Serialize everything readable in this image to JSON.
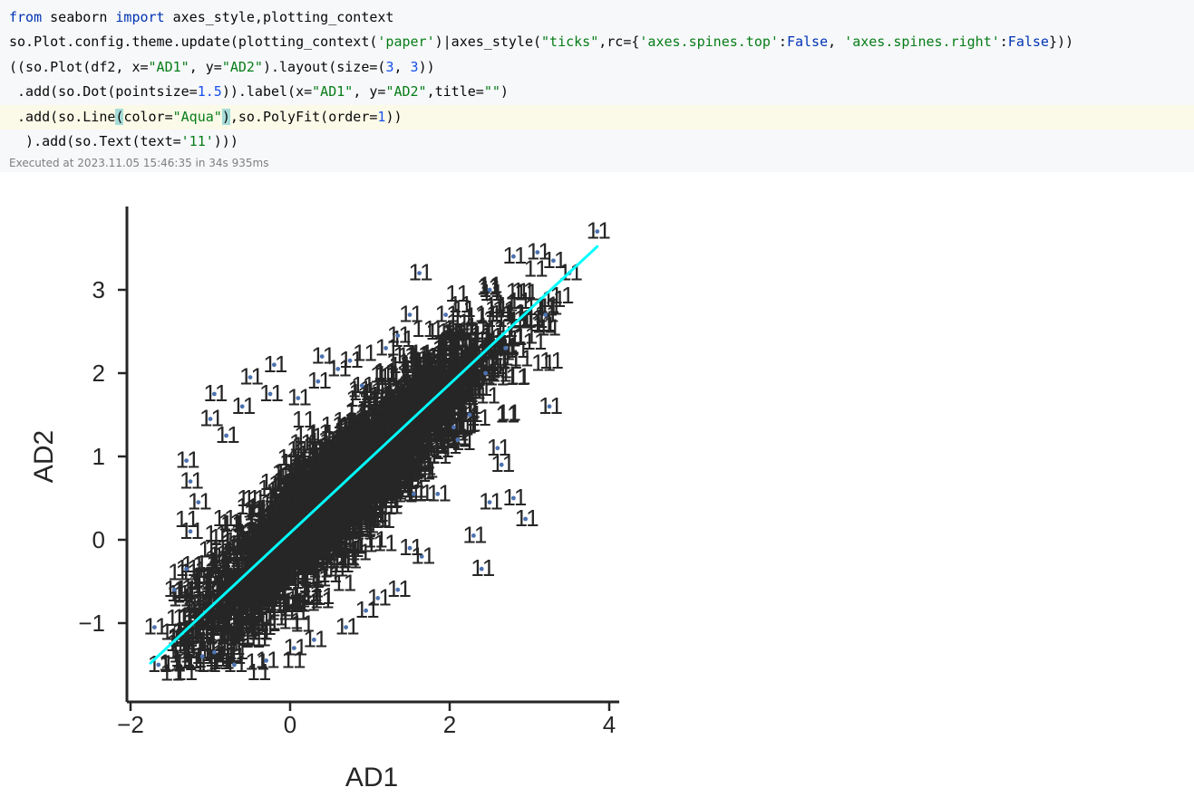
{
  "notebook": {
    "code_lines": [
      [
        {
          "t": "from",
          "c": "kw"
        },
        {
          "t": " seaborn "
        },
        {
          "t": "import",
          "c": "kw"
        },
        {
          "t": " axes_style,plotting_context"
        }
      ],
      [
        {
          "t": "so.Plot.config.theme.update(plotting_context("
        },
        {
          "t": "'paper'",
          "c": "st"
        },
        {
          "t": ")|axes_style("
        },
        {
          "t": "\"ticks\"",
          "c": "st"
        },
        {
          "t": ",rc={"
        },
        {
          "t": "'axes.spines.top'",
          "c": "st"
        },
        {
          "t": ":"
        },
        {
          "t": "False",
          "c": "kw"
        },
        {
          "t": ", "
        },
        {
          "t": "'axes.spines.right'",
          "c": "st"
        },
        {
          "t": ":"
        },
        {
          "t": "False",
          "c": "kw"
        },
        {
          "t": "}))"
        }
      ],
      [
        {
          "t": "((so.Plot(df2, x="
        },
        {
          "t": "\"AD1\"",
          "c": "st"
        },
        {
          "t": ", y="
        },
        {
          "t": "\"AD2\"",
          "c": "st"
        },
        {
          "t": ").layout(size=("
        },
        {
          "t": "3",
          "c": "nu"
        },
        {
          "t": ", "
        },
        {
          "t": "3",
          "c": "nu"
        },
        {
          "t": "))"
        }
      ],
      [
        {
          "t": " .add(so.Dot(pointsize="
        },
        {
          "t": "1.5",
          "c": "nu"
        },
        {
          "t": ")).label(x="
        },
        {
          "t": "\"AD1\"",
          "c": "st"
        },
        {
          "t": ", y="
        },
        {
          "t": "\"AD2\"",
          "c": "st"
        },
        {
          "t": ",title="
        },
        {
          "t": "\"\"",
          "c": "st"
        },
        {
          "t": ")"
        }
      ],
      [
        {
          "t": " .add(so.Line"
        },
        {
          "t": "(",
          "c": "par"
        },
        {
          "t": "color="
        },
        {
          "t": "\"Aqua\"",
          "c": "st"
        },
        {
          "t": ")",
          "c": "par"
        },
        {
          "t": ",so.PolyFit(order="
        },
        {
          "t": "1",
          "c": "nu"
        },
        {
          "t": "))"
        }
      ],
      [
        {
          "t": "  ).add(so.Text(text="
        },
        {
          "t": "'11'",
          "c": "st"
        },
        {
          "t": ")))"
        }
      ]
    ],
    "highlighted_line": 4,
    "execution_info": "Executed at 2023.11.05 15:46:35 in 34s 935ms"
  },
  "chart_data": {
    "type": "scatter",
    "xlabel": "AD1",
    "ylabel": "AD2",
    "title": "",
    "xlim": [
      -2,
      4
    ],
    "ylim": [
      -2,
      4
    ],
    "xticks": [
      -2,
      0,
      2,
      4
    ],
    "yticks": [
      -1,
      0,
      1,
      2,
      3
    ],
    "xtick_labels": [
      "−2",
      "0",
      "2",
      "4"
    ],
    "ytick_labels": [
      "−1",
      "0",
      "1",
      "2",
      "3"
    ],
    "point_text": "11",
    "colors": {
      "dot": "#4c72b0",
      "line": "#00ffff",
      "text": "#262626"
    },
    "fit_line": {
      "x": [
        -1.75,
        3.85
      ],
      "y": [
        -1.48,
        3.52
      ]
    },
    "outlier_points": [
      {
        "x": 3.85,
        "y": 3.7
      },
      {
        "x": 1.62,
        "y": 3.2
      },
      {
        "x": 1.5,
        "y": 2.7
      },
      {
        "x": 1.35,
        "y": 2.45
      },
      {
        "x": 0.75,
        "y": 2.15
      },
      {
        "x": 0.6,
        "y": 2.05
      },
      {
        "x": 0.35,
        "y": 1.9
      },
      {
        "x": -0.2,
        "y": 2.1
      },
      {
        "x": -0.5,
        "y": 1.95
      },
      {
        "x": -0.95,
        "y": 1.75
      },
      {
        "x": -1.3,
        "y": 0.95
      },
      {
        "x": -1.25,
        "y": 0.7
      },
      {
        "x": 3.25,
        "y": 1.6
      },
      {
        "x": 2.6,
        "y": 1.1
      },
      {
        "x": 2.65,
        "y": 0.9
      },
      {
        "x": 2.5,
        "y": 0.45
      },
      {
        "x": 2.8,
        "y": 0.5
      },
      {
        "x": 2.95,
        "y": 0.25
      },
      {
        "x": 2.3,
        "y": 0.05
      },
      {
        "x": 2.4,
        "y": -0.35
      },
      {
        "x": 2.8,
        "y": 3.4
      },
      {
        "x": 3.2,
        "y": 2.7
      },
      {
        "x": 3.5,
        "y": 3.2
      },
      {
        "x": 3.1,
        "y": 3.45
      },
      {
        "x": -1.65,
        "y": -1.5
      },
      {
        "x": -1.7,
        "y": -1.05
      },
      {
        "x": -0.7,
        "y": -1.5
      },
      {
        "x": -0.95,
        "y": -1.35
      },
      {
        "x": -1.1,
        "y": -1.4
      },
      {
        "x": 0.05,
        "y": -1.3
      },
      {
        "x": 0.3,
        "y": -1.2
      },
      {
        "x": 0.7,
        "y": -1.05
      },
      {
        "x": 1.35,
        "y": -0.6
      },
      {
        "x": 1.65,
        "y": -0.2
      },
      {
        "x": 1.5,
        "y": -0.1
      },
      {
        "x": 1.55,
        "y": 0.55
      },
      {
        "x": 1.85,
        "y": 0.55
      },
      {
        "x": 2.1,
        "y": 1.2
      },
      {
        "x": 2.05,
        "y": 1.35
      },
      {
        "x": -1.25,
        "y": 0.1
      },
      {
        "x": -1.3,
        "y": -0.35
      },
      {
        "x": -1.45,
        "y": -0.6
      },
      {
        "x": -1.15,
        "y": 0.45
      },
      {
        "x": -0.8,
        "y": 1.25
      },
      {
        "x": -0.6,
        "y": 1.6
      },
      {
        "x": 0.1,
        "y": 1.7
      },
      {
        "x": 0.9,
        "y": 1.85
      },
      {
        "x": 1.2,
        "y": 2.3
      },
      {
        "x": 1.95,
        "y": 2.7
      },
      {
        "x": 2.5,
        "y": 3.0
      },
      {
        "x": 3.3,
        "y": 3.35
      },
      {
        "x": 0.95,
        "y": -0.85
      },
      {
        "x": 1.1,
        "y": -0.7
      },
      {
        "x": -0.3,
        "y": -1.45
      },
      {
        "x": 2.25,
        "y": 1.5
      },
      {
        "x": 2.45,
        "y": 2.0
      },
      {
        "x": 2.7,
        "y": 2.3
      },
      {
        "x": -1.0,
        "y": 1.45
      },
      {
        "x": 0.4,
        "y": 2.2
      },
      {
        "x": -0.25,
        "y": 1.75
      }
    ]
  }
}
